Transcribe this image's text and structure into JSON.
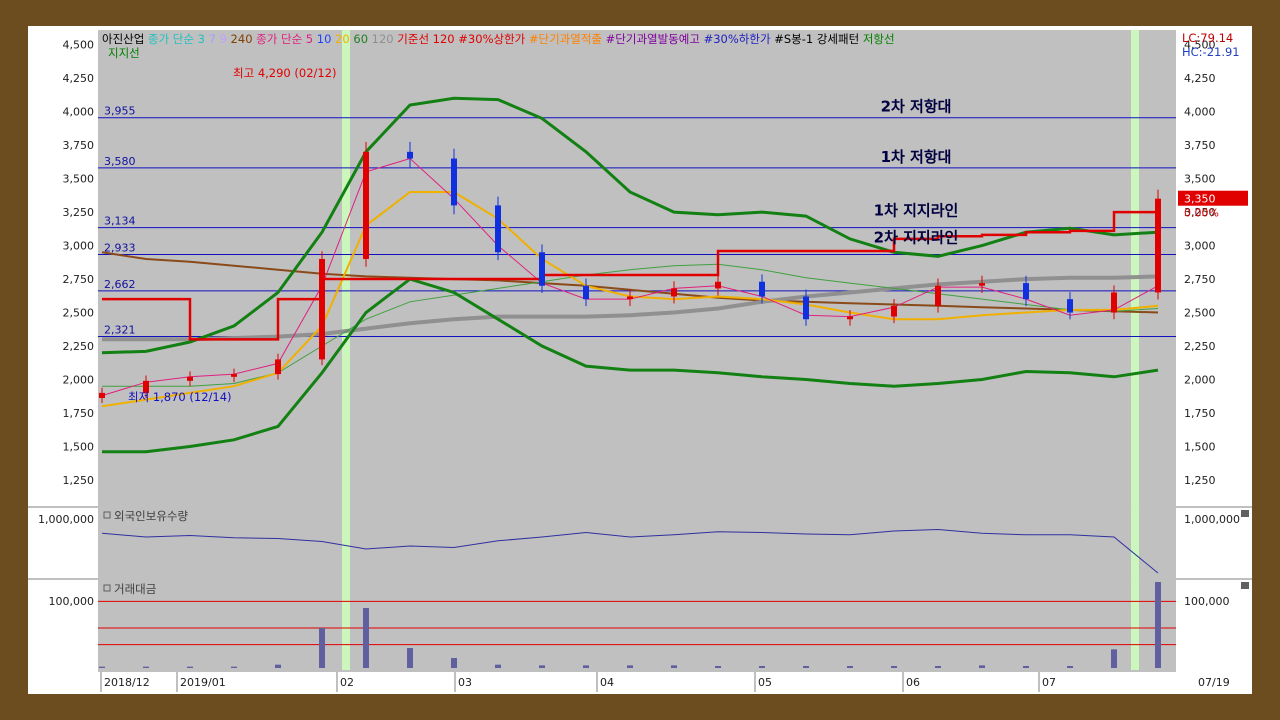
{
  "chart_data": [
    {
      "type": "candlestick",
      "title": "아진산업",
      "legend": [
        {
          "text": "아진산업",
          "color": "#000000"
        },
        {
          "text": "종가 단순 3",
          "color": "#20c0c0"
        },
        {
          "text": "7",
          "color": "#a0a0ff"
        },
        {
          "text": "9",
          "color": "#c0a0ff"
        },
        {
          "text": "240",
          "color": "#804000"
        },
        {
          "text": "종가 단순 5",
          "color": "#e0207f"
        },
        {
          "text": "10",
          "color": "#2040ff"
        },
        {
          "text": "20",
          "color": "#f0b000"
        },
        {
          "text": "60",
          "color": "#208020"
        },
        {
          "text": "120",
          "color": "#909090"
        },
        {
          "text": "기준선 120",
          "color": "#e00000"
        },
        {
          "text": "#30%상한가",
          "color": "#e00000"
        },
        {
          "text": "#단기과열적출",
          "color": "#ff8000"
        },
        {
          "text": "#단기과열발동예고",
          "color": "#8000a0"
        },
        {
          "text": "#30%하한가",
          "color": "#2020c0"
        },
        {
          "text": "#S봉-1 강세패턴",
          "color": "#000000"
        },
        {
          "text": "저항선",
          "color": "#008000"
        }
      ],
      "legend_line2": "지지선",
      "top_right": {
        "lc": "LC:79.14",
        "hc": "HC:-21.91"
      },
      "y_ticks": [
        1250,
        1500,
        1750,
        2000,
        2250,
        2500,
        2750,
        3000,
        3250,
        3500,
        3750,
        4000,
        4250,
        4500
      ],
      "y_tick_labels": [
        "1,250",
        "1,500",
        "1,750",
        "2,000",
        "2,250",
        "2,500",
        "2,750",
        "3,000",
        "3,250",
        "3,500",
        "3,750",
        "4,000",
        "4,250",
        "4,500"
      ],
      "ylim": [
        1130,
        4580
      ],
      "x_labels": [
        "2018/12",
        "2019/01",
        "02",
        "03",
        "04",
        "05",
        "06",
        "07",
        "07/19"
      ],
      "horizontal_levels": [
        {
          "value": 3955,
          "label": "3,955"
        },
        {
          "value": 3580,
          "label": "3,580"
        },
        {
          "value": 3134,
          "label": "3,134"
        },
        {
          "value": 2933,
          "label": "2,933"
        },
        {
          "value": 2662,
          "label": "2,662"
        },
        {
          "value": 2321,
          "label": "2,321"
        }
      ],
      "annotations": [
        {
          "text": "2차 저항대",
          "value": 3955
        },
        {
          "text": "1차 저항대",
          "value": 3580
        },
        {
          "text": "1차 지지라인",
          "value": 3134
        },
        {
          "text": "2차 지지라인",
          "value": 2933
        },
        {
          "text": "최고 4,290 (02/12)",
          "value": 4290
        },
        {
          "text": "최저 1,870 (12/14)",
          "value": 1870
        }
      ],
      "last_price": {
        "label": "3,350",
        "change": "0.00%",
        "value": 3350
      },
      "bollinger_upper": [
        2200,
        2210,
        2280,
        2400,
        2650,
        3100,
        3700,
        4050,
        4100,
        4090,
        3950,
        3700,
        3400,
        3250,
        3230,
        3250,
        3220,
        3050,
        2950,
        2920,
        3000,
        3100,
        3130,
        3080,
        3100
      ],
      "bollinger_lower": [
        1460,
        1460,
        1500,
        1550,
        1650,
        2050,
        2500,
        2750,
        2650,
        2450,
        2250,
        2100,
        2070,
        2070,
        2050,
        2020,
        2000,
        1970,
        1950,
        1970,
        2000,
        2060,
        2050,
        2020,
        2070
      ],
      "ma120": [
        2300,
        2300,
        2300,
        2310,
        2320,
        2340,
        2380,
        2420,
        2450,
        2470,
        2470,
        2470,
        2480,
        2500,
        2530,
        2580,
        2620,
        2650,
        2680,
        2710,
        2730,
        2750,
        2760,
        2760,
        2770
      ],
      "ma240": [
        2950,
        2900,
        2880,
        2850,
        2820,
        2790,
        2770,
        2760,
        2750,
        2740,
        2720,
        2700,
        2670,
        2640,
        2610,
        2590,
        2580,
        2570,
        2560,
        2550,
        2540,
        2530,
        2520,
        2510,
        2500
      ],
      "ma20": [
        1800,
        1850,
        1900,
        1950,
        2050,
        2400,
        3150,
        3400,
        3400,
        3200,
        2900,
        2700,
        2620,
        2600,
        2620,
        2600,
        2560,
        2500,
        2450,
        2450,
        2480,
        2500,
        2520,
        2520,
        2550
      ],
      "ma60": [
        1950,
        1950,
        1950,
        1970,
        2050,
        2250,
        2450,
        2580,
        2630,
        2680,
        2730,
        2780,
        2820,
        2850,
        2860,
        2820,
        2760,
        2720,
        2680,
        2640,
        2600,
        2560,
        2520,
        2510,
        2530
      ],
      "baseline": [
        2600,
        2600,
        2300,
        2300,
        2600,
        2750,
        2750,
        2750,
        2750,
        2750,
        2780,
        2780,
        2780,
        2780,
        2960,
        2960,
        2960,
        2960,
        3050,
        3070,
        3080,
        3100,
        3110,
        3250,
        3280
      ],
      "close": [
        1900,
        1990,
        2020,
        2040,
        2150,
        2900,
        3700,
        3650,
        3300,
        2950,
        2700,
        2600,
        2620,
        2680,
        2730,
        2620,
        2450,
        2470,
        2550,
        2700,
        2720,
        2600,
        2500,
        2650,
        3350
      ],
      "ma5": [
        1880,
        1980,
        2020,
        2040,
        2120,
        2700,
        3550,
        3650,
        3350,
        3000,
        2720,
        2600,
        2600,
        2680,
        2700,
        2620,
        2480,
        2470,
        2540,
        2690,
        2690,
        2600,
        2480,
        2520,
        2700
      ]
    },
    {
      "type": "line",
      "title": "외국인보유수량",
      "y_tick_label": "1,000,000",
      "ylim": [
        700000,
        1100000
      ],
      "values": [
        985000,
        960000,
        970000,
        955000,
        950000,
        930000,
        880000,
        900000,
        890000,
        935000,
        960000,
        990000,
        960000,
        975000,
        995000,
        990000,
        980000,
        975000,
        1000000,
        1010000,
        985000,
        975000,
        975000,
        960000,
        720000
      ]
    },
    {
      "type": "bar",
      "title": "거래대금",
      "y_tick_label": "100,000",
      "ylim": [
        0,
        120000
      ],
      "ref_lines": [
        100000,
        60000,
        35000
      ],
      "values": [
        2000,
        2000,
        2000,
        2000,
        5000,
        60000,
        90000,
        30000,
        15000,
        5000,
        4000,
        4000,
        4000,
        4000,
        3000,
        3000,
        3000,
        3000,
        3000,
        3000,
        4000,
        3000,
        3000,
        28000,
        138000
      ]
    }
  ]
}
